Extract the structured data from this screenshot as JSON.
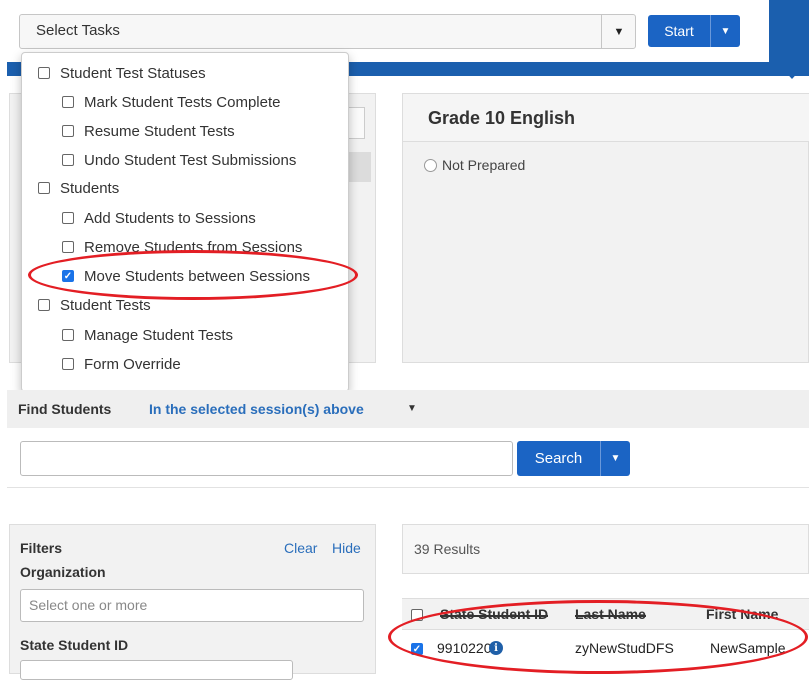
{
  "task_select": {
    "placeholder": "Select Tasks"
  },
  "start_button": {
    "label": "Start"
  },
  "task_menu": {
    "items": [
      {
        "label": "Student Test Statuses",
        "checked": false
      },
      {
        "label": "Mark Student Tests Complete",
        "checked": false
      },
      {
        "label": "Resume Student Tests",
        "checked": false
      },
      {
        "label": "Undo Student Test Submissions",
        "checked": false
      },
      {
        "label": "Students",
        "checked": false
      },
      {
        "label": "Add Students to Sessions",
        "checked": false
      },
      {
        "label": "Remove Students from Sessions",
        "checked": false
      },
      {
        "label": "Move Students between Sessions",
        "checked": true
      },
      {
        "label": "Student Tests",
        "checked": false
      },
      {
        "label": "Manage Student Tests",
        "checked": false
      },
      {
        "label": "Form Override",
        "checked": false
      }
    ]
  },
  "session_panel": {
    "title": "Grade 10 English",
    "status": "Not Prepared"
  },
  "find_students": {
    "label": "Find Students",
    "scope": "In the selected session(s) above",
    "search_label": "Search"
  },
  "filters": {
    "title": "Filters",
    "clear": "Clear",
    "hide": "Hide",
    "organization_label": "Organization",
    "organization_placeholder": "Select one or more",
    "state_student_id_label": "State Student ID"
  },
  "results": {
    "count_text": "39 Results",
    "columns": [
      "State Student ID",
      "Last Name",
      "First Name"
    ],
    "rows": [
      {
        "state_student_id": "9910220",
        "last_name": "zyNewStudDFS",
        "first_name": "NewSample",
        "checked": true
      }
    ]
  },
  "colors": {
    "brand_blue": "#1b5fae",
    "button_blue": "#1b64c4",
    "annotation_red": "#e31e24"
  }
}
